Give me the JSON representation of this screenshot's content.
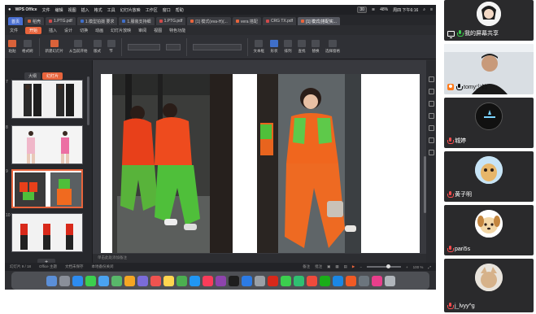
{
  "macbar": {
    "app": "WPS Office",
    "menus": [
      "文件",
      "编辑",
      "视图",
      "插入",
      "格式",
      "工具",
      "幻灯片放映",
      "工作区",
      "窗口",
      "帮助"
    ],
    "share_badge": "30",
    "battery": "48%",
    "clock": "周四 下午6:16"
  },
  "tabs": [
    {
      "label": "首页"
    },
    {
      "label": "稻壳"
    },
    {
      "label": "1.PTG.pdf"
    },
    {
      "label": "1.模型拍摄 要求"
    },
    {
      "label": "1.服装支持细"
    },
    {
      "label": "1.PTG.pdf"
    },
    {
      "label": "[1] 模式(eva-H)(..."
    },
    {
      "label": "vera 搭配"
    },
    {
      "label": "CRG TX.pdf"
    },
    {
      "label": "[1] 模式(搭配实..."
    }
  ],
  "menubar": {
    "items": [
      "文件",
      "开始",
      "插入",
      "设计",
      "切换",
      "动画",
      "幻灯片放映",
      "审阅",
      "视图",
      "特色功能"
    ]
  },
  "ribbon": {
    "groups": [
      "粘贴",
      "格式刷",
      "新建幻灯片",
      "从当前开始",
      "版式",
      "节"
    ],
    "right_groups": [
      "文本框",
      "形状",
      "排列",
      "查找",
      "替换",
      "选择窗格"
    ]
  },
  "slide_panel": {
    "tabs": [
      "大纲",
      "幻灯片"
    ],
    "numbers": [
      "7",
      "8",
      "9",
      "10"
    ],
    "add_label": "+"
  },
  "notes_placeholder": "单击此处添加备注",
  "status": {
    "slide_info": "幻灯片 9 / 18",
    "theme": "Office 主题",
    "font_warn": "文档未保存",
    "backup": "本地备份关闭",
    "notes_btn": "备注",
    "comment_btn": "批注",
    "zoom": "100 %"
  },
  "participants": [
    {
      "name": "我的屏幕共享",
      "type": "screen-share"
    },
    {
      "name": "tomy少钧",
      "type": "camera"
    },
    {
      "name": "城婷",
      "type": "avatar"
    },
    {
      "name": "黄子明",
      "type": "avatar"
    },
    {
      "name": "pari5s",
      "type": "avatar"
    },
    {
      "name": "j_lvyy^g",
      "type": "avatar"
    }
  ],
  "colors": {
    "accent": "#e8643c",
    "wps_blue": "#4a6fd1",
    "mic_active": "#3ccf4e",
    "mic_muted": "#ff4d4f"
  }
}
